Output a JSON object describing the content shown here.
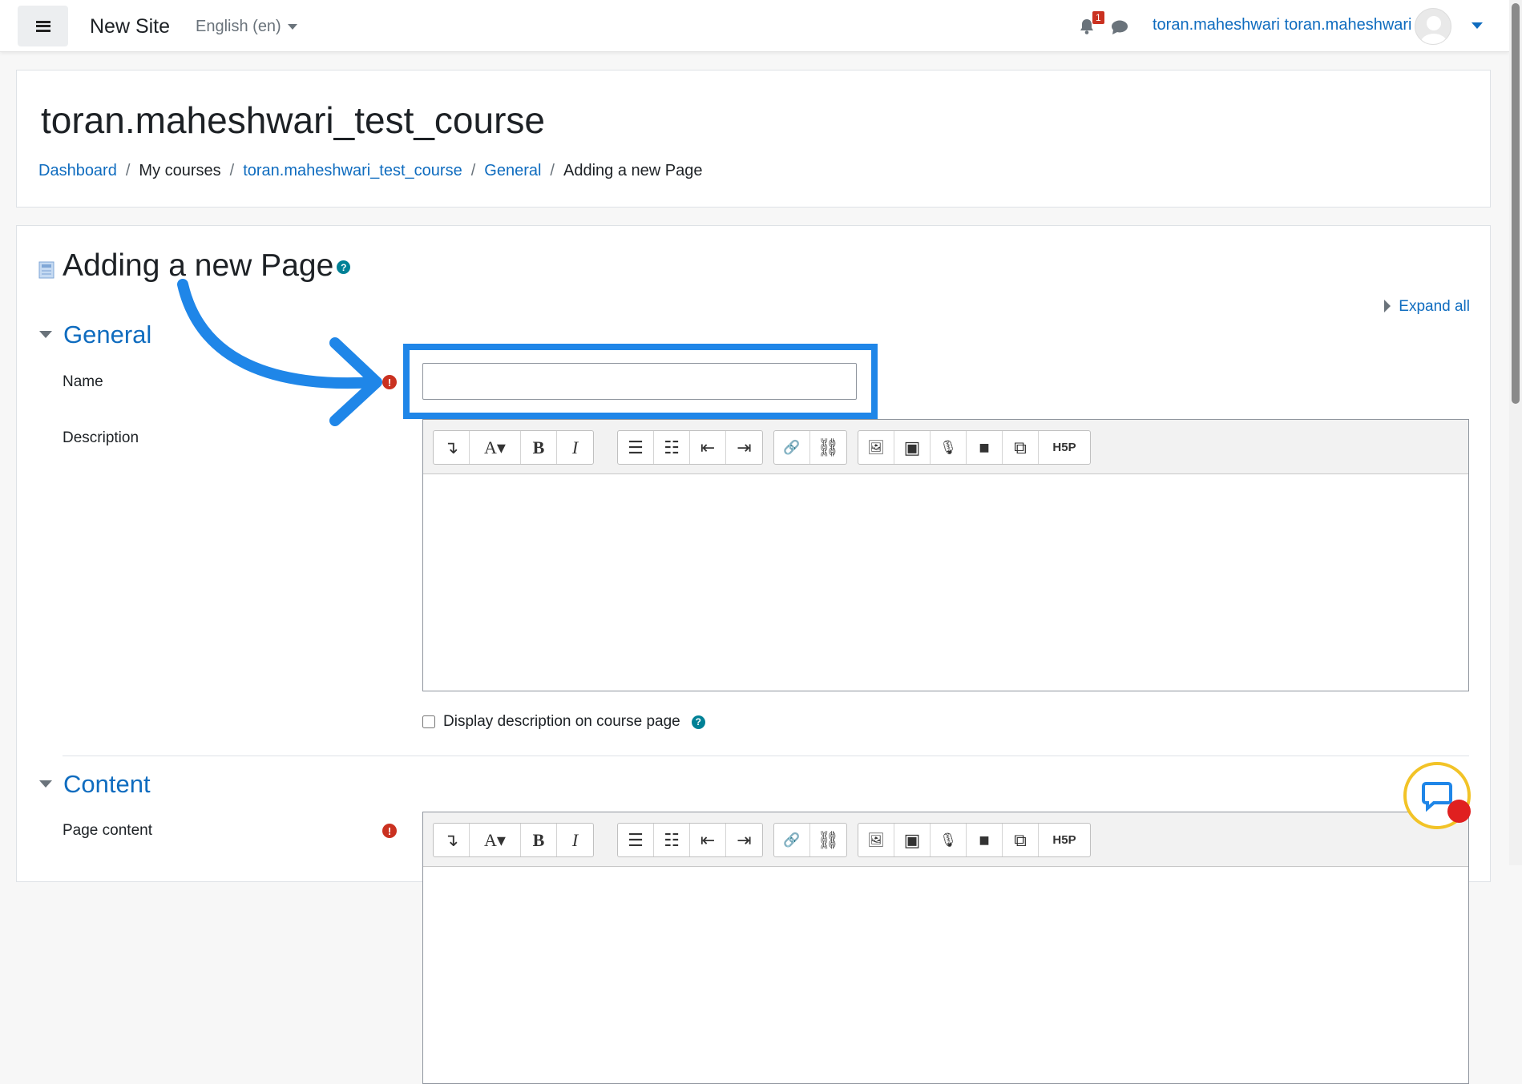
{
  "navbar": {
    "site_name": "New Site",
    "language": "English (en)",
    "notification_count": "1",
    "user_name": "toran.maheshwari toran.maheshwari"
  },
  "header": {
    "course_title": "toran.maheshwari_test_course",
    "breadcrumb": [
      {
        "label": "Dashboard",
        "link": true
      },
      {
        "label": "My courses",
        "link": false
      },
      {
        "label": "toran.maheshwari_test_course",
        "link": true
      },
      {
        "label": "General",
        "link": true
      },
      {
        "label": "Adding a new Page",
        "link": false
      }
    ]
  },
  "main": {
    "heading": "Adding a new Page",
    "help_glyph": "?",
    "expand_all": "Expand all",
    "sections": {
      "general": "General",
      "content": "Content"
    },
    "fields": {
      "name_label": "Name",
      "name_value": "",
      "description_label": "Description",
      "display_description_label": "Display description on course page",
      "display_description_checked": false,
      "page_content_label": "Page content"
    },
    "required_glyph": "!"
  },
  "toolbar_buttons": [
    {
      "group": 1,
      "icon": "more-toolbar-icon",
      "glyph": "↴"
    },
    {
      "group": 1,
      "icon": "font-style-icon",
      "glyph": "A▾"
    },
    {
      "group": 1,
      "icon": "bold-icon",
      "glyph": "B"
    },
    {
      "group": 1,
      "icon": "italic-icon",
      "glyph": "I"
    },
    {
      "group": 2,
      "icon": "unordered-list-icon",
      "glyph": "☰"
    },
    {
      "group": 2,
      "icon": "ordered-list-icon",
      "glyph": "☷"
    },
    {
      "group": 2,
      "icon": "outdent-icon",
      "glyph": "⇤"
    },
    {
      "group": 2,
      "icon": "indent-icon",
      "glyph": "⇥"
    },
    {
      "group": 3,
      "icon": "link-icon",
      "glyph": "🔗"
    },
    {
      "group": 3,
      "icon": "unlink-icon",
      "glyph": "⛓"
    },
    {
      "group": 4,
      "icon": "image-icon",
      "glyph": "🖼"
    },
    {
      "group": 4,
      "icon": "media-icon",
      "glyph": "▣"
    },
    {
      "group": 4,
      "icon": "microphone-icon",
      "glyph": "🎙"
    },
    {
      "group": 4,
      "icon": "video-icon",
      "glyph": "■"
    },
    {
      "group": 4,
      "icon": "manage-files-icon",
      "glyph": "⧉"
    },
    {
      "group": 4,
      "icon": "h5p-icon",
      "glyph": "H5P"
    }
  ],
  "colors": {
    "link": "#0f6cbf",
    "required": "#ca3120",
    "help": "#008196",
    "annotation_blue": "#1f86e8",
    "chat_ring": "#f2c327",
    "chat_dot": "#e02020"
  }
}
